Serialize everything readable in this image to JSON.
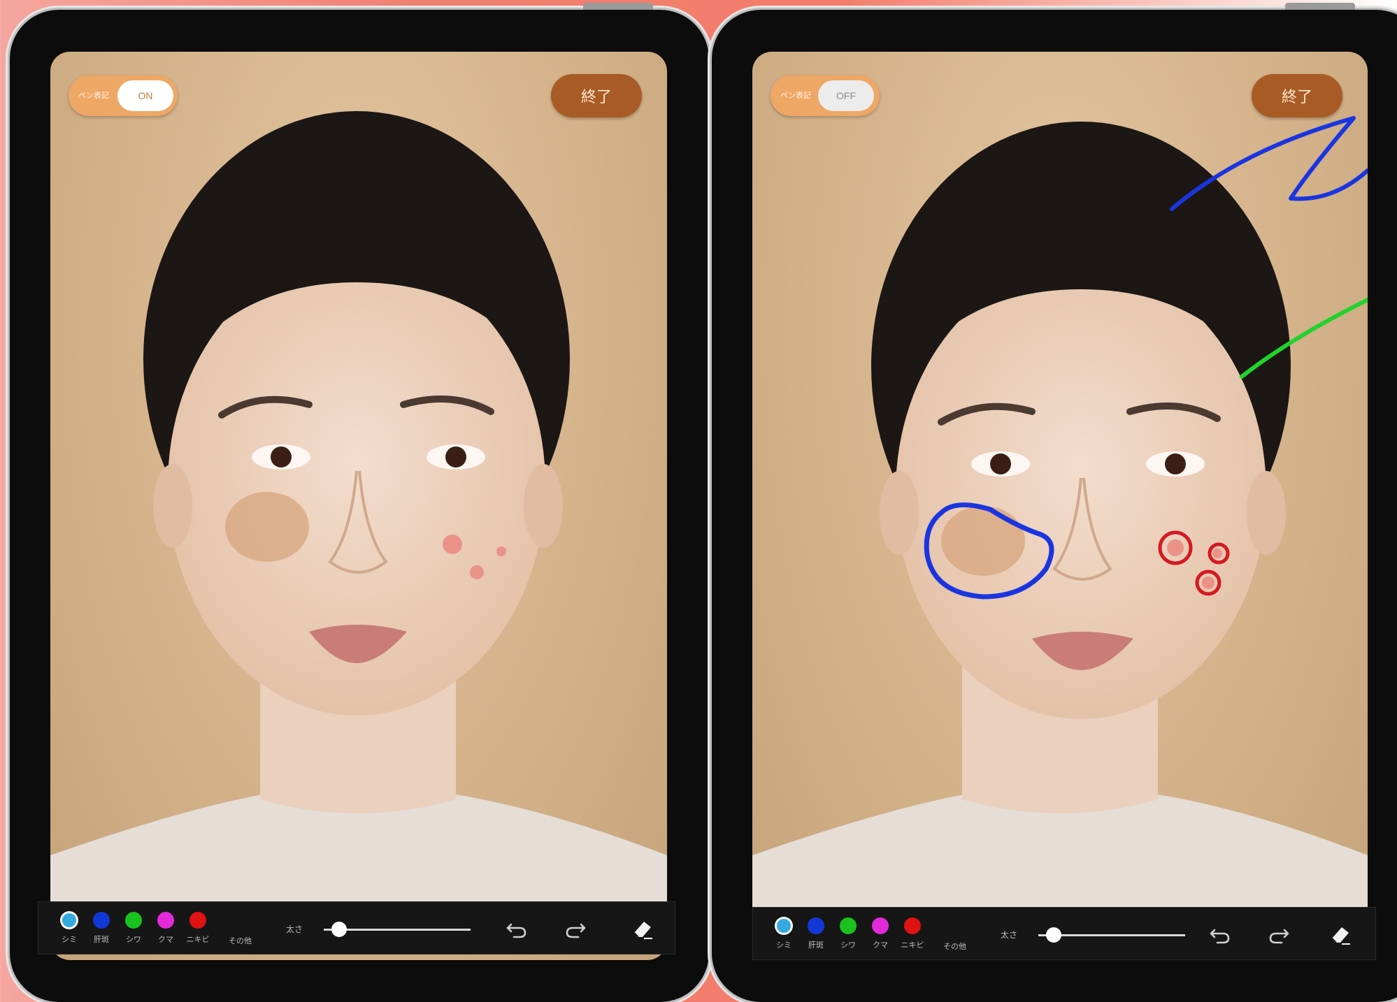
{
  "left_tablet": {
    "toggle": {
      "label": "ペン表記",
      "state": "ON"
    },
    "end_button": "終了",
    "palette": [
      {
        "label": "シミ",
        "color": "#35a9e0",
        "selected": true
      },
      {
        "label": "肝斑",
        "color": "#1238d8",
        "selected": false
      },
      {
        "label": "シワ",
        "color": "#19c21f",
        "selected": false
      },
      {
        "label": "クマ",
        "color": "#e22ad8",
        "selected": false
      },
      {
        "label": "ニキビ",
        "color": "#e01212",
        "selected": false
      }
    ],
    "other_label": "その他",
    "size_label": "太さ",
    "size_value": 0.05
  },
  "right_tablet": {
    "toggle": {
      "label": "ペン表記",
      "state": "OFF"
    },
    "end_button": "終了",
    "palette": [
      {
        "label": "シミ",
        "color": "#35a9e0",
        "selected": true
      },
      {
        "label": "肝斑",
        "color": "#1238d8",
        "selected": false
      },
      {
        "label": "シワ",
        "color": "#19c21f",
        "selected": false
      },
      {
        "label": "クマ",
        "color": "#e22ad8",
        "selected": false
      },
      {
        "label": "ニキビ",
        "color": "#e01212",
        "selected": false
      }
    ],
    "other_label": "その他",
    "size_label": "太さ",
    "size_value": 0.05,
    "annotation_colors": {
      "blue": "#1a35e0",
      "green": "#22d22e",
      "red": "#d41a22"
    }
  },
  "icons": {
    "undo": "undo-icon",
    "redo": "redo-icon",
    "eraser": "eraser-icon"
  }
}
